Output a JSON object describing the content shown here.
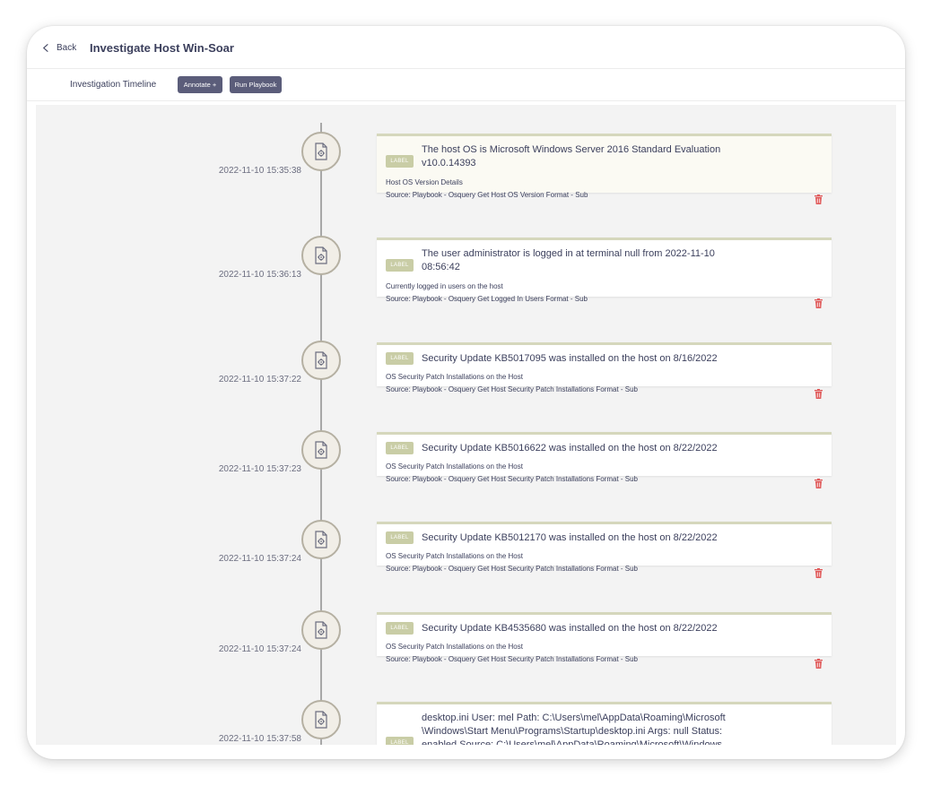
{
  "header": {
    "back_label": "Back",
    "title": "Investigate Host Win-Soar"
  },
  "toolbar": {
    "tab_label": "Investigation Timeline",
    "annotate_label": "Annotate +",
    "run_playbook_label": "Run Playbook"
  },
  "colors": {
    "button_bg": "#5b5d7a",
    "badge_bg": "#c9cda6",
    "card_border": "#d5d7bc",
    "delete_icon": "#e05a5a",
    "timeline_line": "#a8a8a8"
  },
  "icons": {
    "back": "chevron-left-icon",
    "node": "document-gear-icon",
    "delete": "trash-icon"
  },
  "timeline": [
    {
      "timestamp": "2022-11-10 15:35:38",
      "badge": "LABEL",
      "title": "The host OS is Microsoft Windows Server 2016 Standard Evaluation v10.0.14393",
      "description": "Host OS Version Details",
      "source": "Source: Playbook - Osquery Get Host OS Version Format - Sub"
    },
    {
      "timestamp": "2022-11-10 15:36:13",
      "badge": "LABEL",
      "title": "The user administrator is logged in at terminal null from 2022-11-10 08:56:42",
      "description": "Currently logged in users on the host",
      "source": "Source: Playbook - Osquery Get Logged In Users Format - Sub"
    },
    {
      "timestamp": "2022-11-10 15:37:22",
      "badge": "LABEL",
      "title": "Security Update KB5017095 was installed on the host on 8/16/2022",
      "description": "OS Security Patch Installations on the Host",
      "source": "Source: Playbook - Osquery Get Host Security Patch Installations Format - Sub"
    },
    {
      "timestamp": "2022-11-10 15:37:23",
      "badge": "LABEL",
      "title": "Security Update KB5016622 was installed on the host on 8/22/2022",
      "description": "OS Security Patch Installations on the Host",
      "source": "Source: Playbook - Osquery Get Host Security Patch Installations Format - Sub"
    },
    {
      "timestamp": "2022-11-10 15:37:24",
      "badge": "LABEL",
      "title": "Security Update KB5012170 was installed on the host on 8/22/2022",
      "description": "OS Security Patch Installations on the Host",
      "source": "Source: Playbook - Osquery Get Host Security Patch Installations Format - Sub"
    },
    {
      "timestamp": "2022-11-10 15:37:24",
      "badge": "LABEL",
      "title": "Security Update KB4535680 was installed on the host on 8/22/2022",
      "description": "OS Security Patch Installations on the Host",
      "source": "Source: Playbook - Osquery Get Host Security Patch Installations Format - Sub"
    },
    {
      "timestamp": "2022-11-10 15:37:58",
      "badge": "LABEL",
      "title": "desktop.ini User: mel Path: C:\\Users\\mel\\AppData\\Roaming\\Microsoft \\Windows\\Start Menu\\Programs\\Startup\\desktop.ini Args: null Status: enabled Source: C:\\Users\\mel\\AppData\\Roaming\\Microsoft\\Windows"
    }
  ]
}
